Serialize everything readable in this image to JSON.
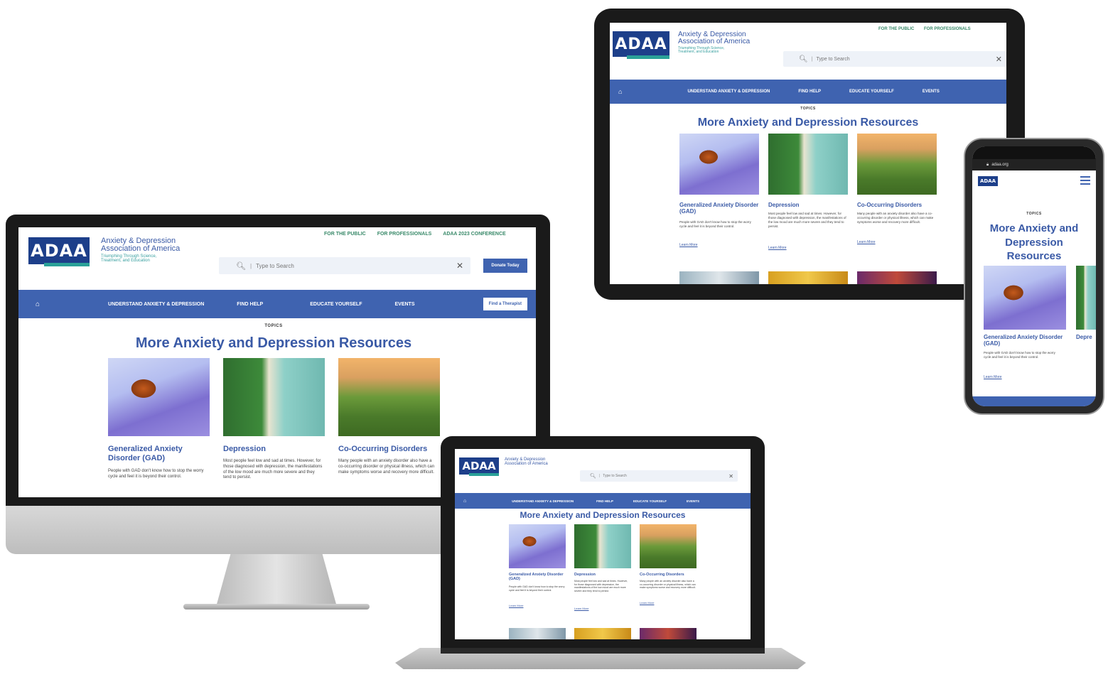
{
  "site": {
    "logo": "ADAA",
    "org_line1": "Anxiety & Depression",
    "org_line2": "Association of America",
    "tagline_line1": "Triumphing Through Science,",
    "tagline_line2": "Treatment, and Education",
    "top_links": [
      "FOR THE PUBLIC",
      "FOR PROFESSIONALS",
      "ADAA 2023 CONFERENCE"
    ],
    "search_placeholder": "Type to Search",
    "donate_button": "Donate Today",
    "nav": [
      "UNDERSTAND ANXIETY & DEPRESSION",
      "FIND HELP",
      "EDUCATE YOURSELF",
      "EVENTS"
    ],
    "find_therapist": "Find a Therapist",
    "topics_label": "TOPICS",
    "heading": "More Anxiety and Depression Resources",
    "cards": [
      {
        "title": "Generalized Anxiety Disorder (GAD)",
        "text": "People with GAD don't know how to stop the worry cycle and feel it is beyond their control."
      },
      {
        "title": "Depression",
        "text": "Most people feel low and sad at times. However, for those diagnosed with depression, the manifestations of the low mood are much more severe and they tend to persist."
      },
      {
        "title": "Co-Occurring Disorders",
        "text": "Many people with an anxiety disorder also have a co-occurring disorder or physical illness, which can make symptoms worse and recovery more difficult."
      }
    ],
    "learn_more": "Learn More"
  },
  "phone": {
    "url": "adaa.org",
    "heading_line1": "More Anxiety and",
    "heading_line2": "Depression",
    "heading_line3": "Resources",
    "card_title_partial": "Depre"
  },
  "colors": {
    "brand_blue": "#3f63b0",
    "logo_navy": "#1d3f8a",
    "accent_teal": "#2aa198"
  }
}
